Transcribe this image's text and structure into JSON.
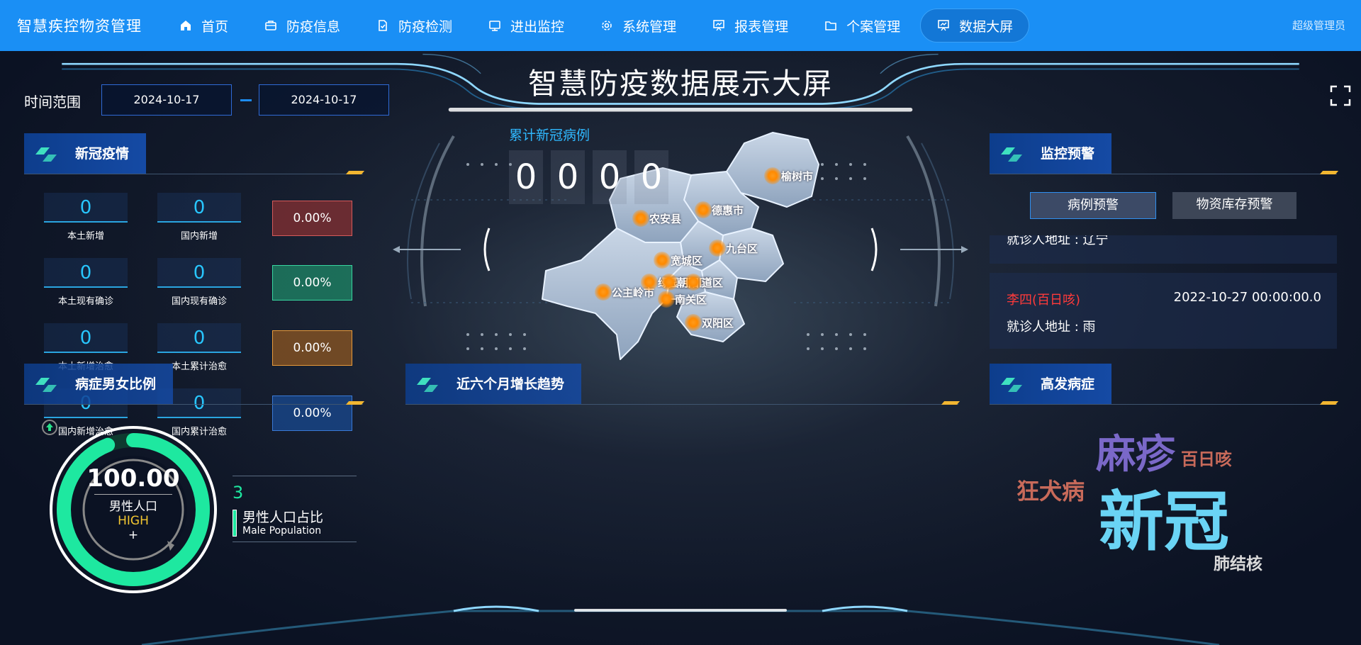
{
  "nav": {
    "brand": "智慧疾控物资管理",
    "items": [
      {
        "label": "首页",
        "icon": "home-icon"
      },
      {
        "label": "防疫信息",
        "icon": "briefcase-icon"
      },
      {
        "label": "防疫检测",
        "icon": "document-check-icon"
      },
      {
        "label": "进出监控",
        "icon": "monitor-icon"
      },
      {
        "label": "系统管理",
        "icon": "gear-icon"
      },
      {
        "label": "报表管理",
        "icon": "chart-board-icon"
      },
      {
        "label": "个案管理",
        "icon": "folder-icon"
      },
      {
        "label": "数据大屏",
        "icon": "chart-board-icon",
        "active": true
      }
    ],
    "user": "超级管理员"
  },
  "screen": {
    "title": "智慧防疫数据展示大屏",
    "range_label": "时间范围",
    "start_date": "2024-10-17",
    "end_date": "2024-10-17"
  },
  "epidemic": {
    "header": "新冠疫情",
    "stats": [
      {
        "value": "0",
        "label": "本土新增"
      },
      {
        "value": "0",
        "label": "国内新增"
      },
      {
        "value": "0",
        "label": "本土现有确诊"
      },
      {
        "value": "0",
        "label": "国内现有确诊"
      },
      {
        "value": "0",
        "label": "本土新增治愈"
      },
      {
        "value": "0",
        "label": "本土累计治愈"
      },
      {
        "value": "0",
        "label": "国内新增治愈"
      },
      {
        "value": "0",
        "label": "国内累计治愈"
      }
    ],
    "percents": [
      "0.00%",
      "0.00%",
      "0.00%",
      "0.00%"
    ],
    "percent_colors": [
      "#7a2a2a",
      "#1f8a6a",
      "#9a5a1a",
      "#1a4d95"
    ]
  },
  "gender": {
    "header": "病症男女比例",
    "value": "100.00",
    "label": "男性人口",
    "level": "HIGH",
    "plus": "+",
    "count": "3",
    "ratio_title": "男性人口占比",
    "ratio_sub": "Male Population",
    "ring_fraction": 1.0
  },
  "map": {
    "cumulative_label": "累计新冠病例",
    "digits": [
      "0",
      "0",
      "0",
      "0"
    ],
    "cities": [
      "榆树市",
      "德惠市",
      "农安县",
      "九台区",
      "宽城区",
      "公主岭市",
      "绿园区",
      "朝阳区",
      "道区",
      "南关区",
      "双阳区"
    ]
  },
  "trend": {
    "header": "近六个月增长趋势"
  },
  "alarm": {
    "header": "监控预警",
    "tabs": [
      "病例预警",
      "物资库存预警"
    ],
    "partial_addr": "就诊人地址 : 辽宁",
    "card": {
      "name": "李四(百日咳)",
      "time": "2022-10-27 00:00:00.0",
      "addr": "就诊人地址 : 雨"
    }
  },
  "diseases": {
    "header": "高发病症",
    "words": [
      {
        "text": "麻疹",
        "color": "#7a68c8"
      },
      {
        "text": "百日咳",
        "color": "#c86a5a"
      },
      {
        "text": "狂犬病",
        "color": "#c86a5a"
      },
      {
        "text": "新冠",
        "color": "#6ad4f5"
      },
      {
        "text": "肺结核",
        "color": "#d9d9d9"
      }
    ]
  }
}
